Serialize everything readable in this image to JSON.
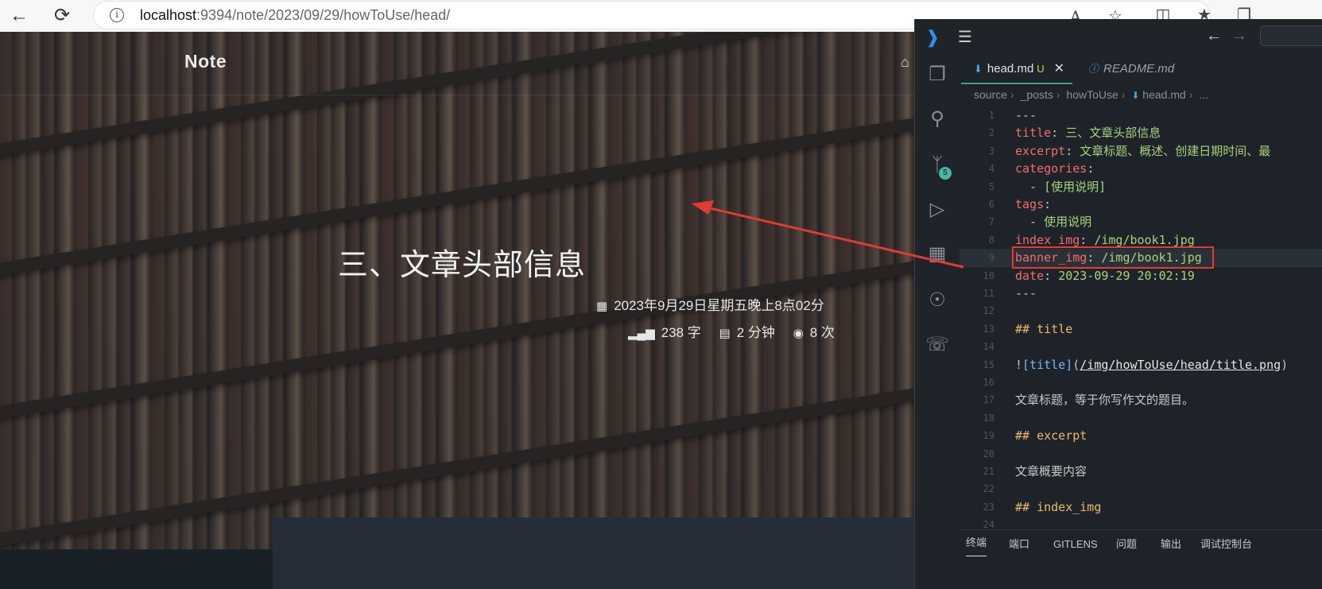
{
  "browser": {
    "back_icon": "arrow-left-icon",
    "reload_icon": "reload-icon",
    "url_host": "localhost",
    "url_path": ":9394/note/2023/09/29/howToUse/head/",
    "read_aloud_label": "A"
  },
  "blog": {
    "brand": "Note",
    "title": "三、文章头部信息",
    "date": "2023年9月29日星期五晚上8点02分",
    "words": "238 字",
    "read_time": "2 分钟",
    "views": "8 次"
  },
  "vscode": {
    "scm_badge": "5",
    "tabs": [
      {
        "label": "head.md",
        "modified": "U"
      },
      {
        "label": "README.md"
      }
    ],
    "breadcrumb": [
      "source",
      "_posts",
      "howToUse",
      "head.md",
      "..."
    ],
    "lines": [
      {
        "n": "1",
        "parts": [
          {
            "c": "p",
            "t": "---"
          }
        ]
      },
      {
        "n": "2",
        "parts": [
          {
            "c": "k",
            "t": "title"
          },
          {
            "c": "p",
            "t": ": "
          },
          {
            "c": "s",
            "t": "三、文章头部信息"
          }
        ]
      },
      {
        "n": "3",
        "parts": [
          {
            "c": "k",
            "t": "excerpt"
          },
          {
            "c": "p",
            "t": ": "
          },
          {
            "c": "s",
            "t": "文章标题、概述、创建日期时间、最"
          }
        ]
      },
      {
        "n": "4",
        "parts": [
          {
            "c": "k",
            "t": "categories"
          },
          {
            "c": "p",
            "t": ":"
          }
        ]
      },
      {
        "n": "5",
        "parts": [
          {
            "c": "p",
            "t": "  - "
          },
          {
            "c": "s",
            "t": "[使用说明]"
          }
        ]
      },
      {
        "n": "6",
        "parts": [
          {
            "c": "k",
            "t": "tags"
          },
          {
            "c": "p",
            "t": ":"
          }
        ]
      },
      {
        "n": "7",
        "parts": [
          {
            "c": "p",
            "t": "  - "
          },
          {
            "c": "s",
            "t": "使用说明"
          }
        ]
      },
      {
        "n": "8",
        "parts": [
          {
            "c": "k",
            "t": "index_img"
          },
          {
            "c": "p",
            "t": ": "
          },
          {
            "c": "s",
            "t": "/img/book1.jpg"
          }
        ]
      },
      {
        "n": "9",
        "parts": [
          {
            "c": "k",
            "t": "banner_img"
          },
          {
            "c": "p",
            "t": ": "
          },
          {
            "c": "s",
            "t": "/img/book1.jpg"
          }
        ]
      },
      {
        "n": "10",
        "parts": [
          {
            "c": "k",
            "t": "date"
          },
          {
            "c": "p",
            "t": ": "
          },
          {
            "c": "s",
            "t": "2023-09-29 20:02:19"
          }
        ]
      },
      {
        "n": "11",
        "parts": [
          {
            "c": "p",
            "t": "---"
          }
        ]
      },
      {
        "n": "12",
        "parts": []
      },
      {
        "n": "13",
        "parts": [
          {
            "c": "hd",
            "t": "## title"
          }
        ]
      },
      {
        "n": "14",
        "parts": []
      },
      {
        "n": "15",
        "parts": [
          {
            "c": "p",
            "t": "!"
          },
          {
            "c": "lk",
            "t": "[title]"
          },
          {
            "c": "p",
            "t": "("
          },
          {
            "c": "ul",
            "t": "/img/howToUse/head/title.png"
          },
          {
            "c": "p",
            "t": ")"
          }
        ]
      },
      {
        "n": "16",
        "parts": []
      },
      {
        "n": "17",
        "parts": [
          {
            "c": "p",
            "t": "文章标题，等于你写作文的题目。"
          }
        ]
      },
      {
        "n": "18",
        "parts": []
      },
      {
        "n": "19",
        "parts": [
          {
            "c": "hd",
            "t": "## excerpt"
          }
        ]
      },
      {
        "n": "20",
        "parts": []
      },
      {
        "n": "21",
        "parts": [
          {
            "c": "p",
            "t": "文章概要内容"
          }
        ]
      },
      {
        "n": "22",
        "parts": []
      },
      {
        "n": "23",
        "parts": [
          {
            "c": "hd",
            "t": "## index_img"
          }
        ]
      },
      {
        "n": "24",
        "parts": []
      }
    ],
    "panel_tabs": [
      "终端",
      "端口",
      "GITLENS",
      "问题",
      "输出",
      "调试控制台"
    ]
  },
  "colors": {
    "annotation_red": "#e33a34",
    "yaml_key": "#f16d6d",
    "yaml_string": "#a8d27c",
    "accent_teal": "#3ea08c"
  }
}
